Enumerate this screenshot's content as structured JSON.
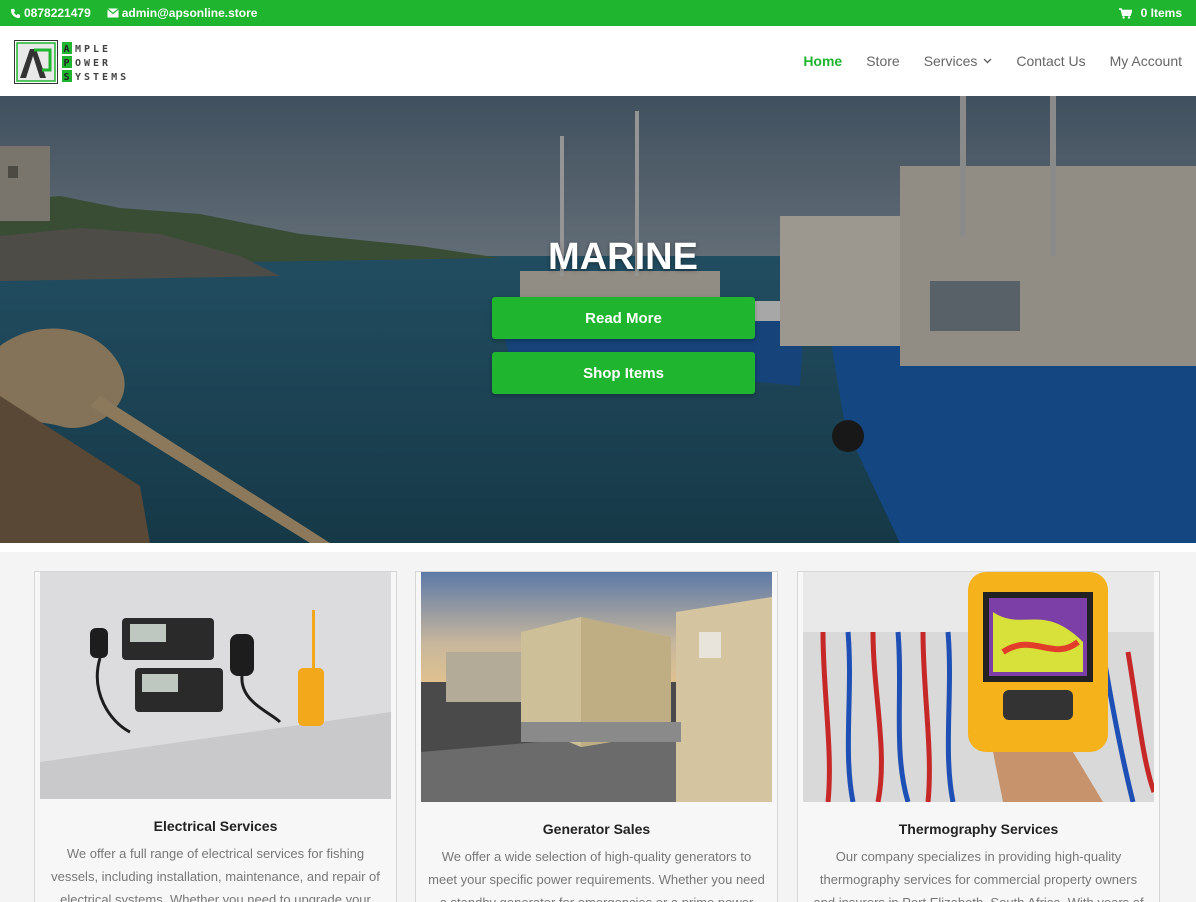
{
  "topbar": {
    "phone": "0878221479",
    "email": "admin@apsonline.store",
    "cart": "0 Items",
    "icons": [
      "phone-icon",
      "mail-icon",
      "cart-icon"
    ]
  },
  "header": {
    "logo_letters": [
      "A",
      "P",
      "S"
    ],
    "logo_lines": [
      "MPLE",
      "OWER",
      "YSTEMS"
    ],
    "nav": [
      {
        "label": "Home",
        "active": true
      },
      {
        "label": "Store"
      },
      {
        "label": "Services"
      },
      {
        "label": "Contact Us"
      },
      {
        "label": "My Account"
      }
    ]
  },
  "hero": {
    "title": "MARINE",
    "read_more": "Read More",
    "shop_items": "Shop Items"
  },
  "cards": [
    {
      "title": "Electrical Services",
      "text": "We offer a full range of electrical services for fishing vessels, including installation, maintenance, and repair of electrical systems. Whether you need to upgrade your"
    },
    {
      "title": "Generator Sales",
      "text": "We offer a wide selection of high-quality generators to meet your specific power requirements. Whether you need a standby generator for emergencies or a prime power"
    },
    {
      "title": "Thermography Services",
      "text": "Our company specializes in providing high-quality thermography services for commercial property owners and insurers in Port Elizabeth, South Africa. With years of"
    }
  ],
  "colors": {
    "brand_green": "#1fb52f",
    "nav_text": "#666666"
  }
}
